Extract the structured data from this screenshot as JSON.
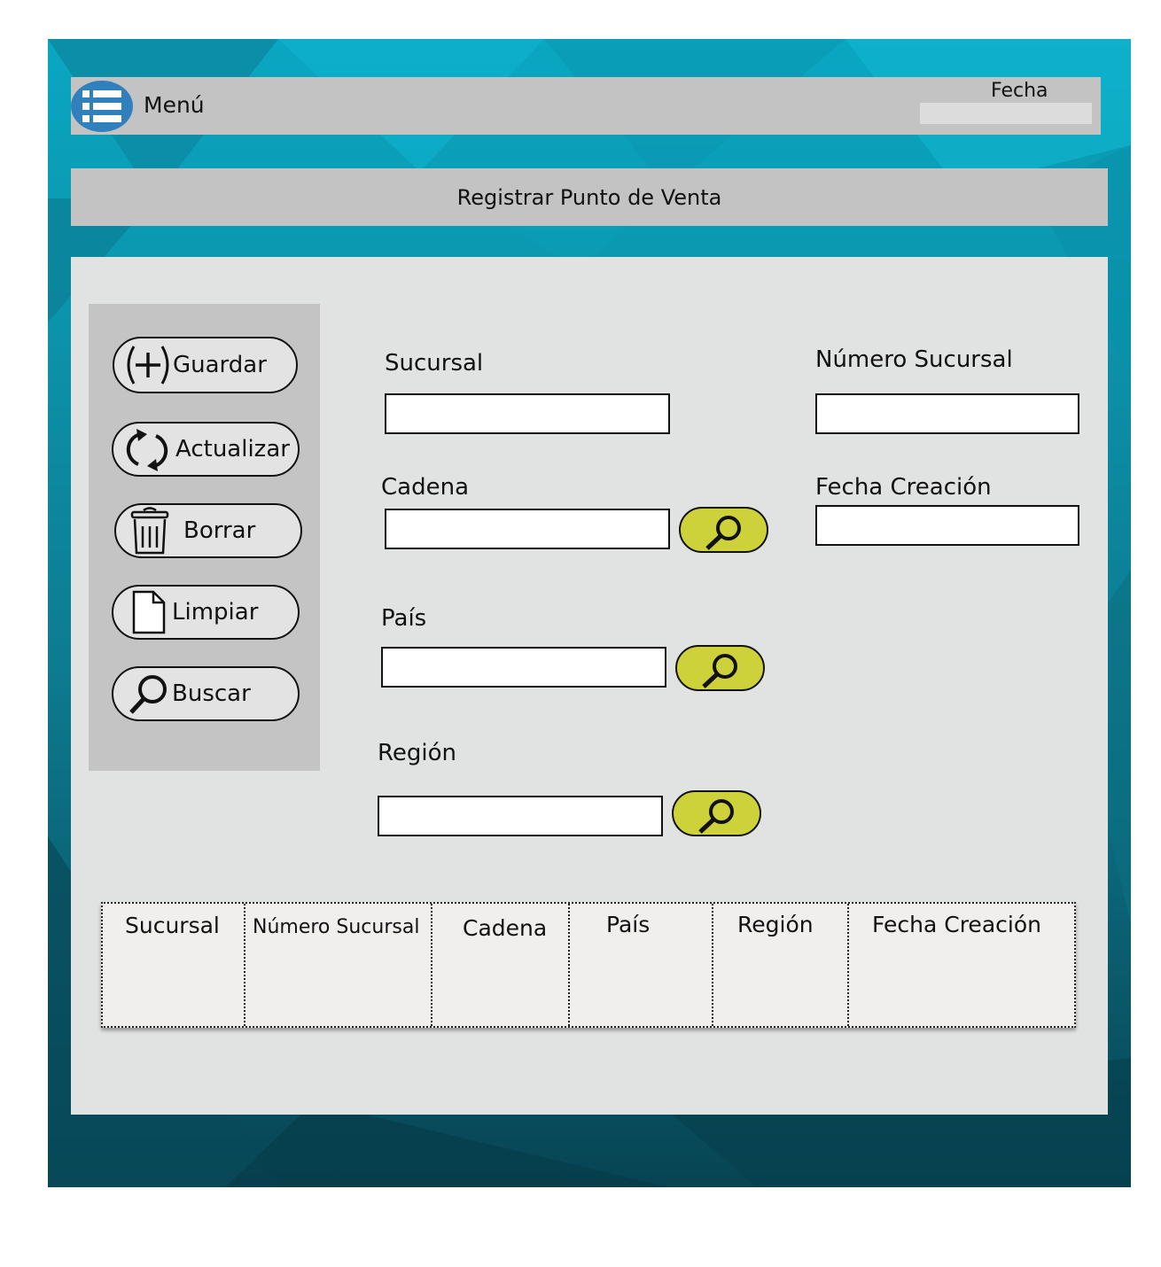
{
  "header": {
    "menu_label": "Menú",
    "fecha_label": "Fecha",
    "fecha_value": ""
  },
  "title": "Registrar Punto de Venta",
  "toolbar": {
    "guardar": "Guardar",
    "actualizar": "Actualizar",
    "borrar": "Borrar",
    "limpiar": "Limpiar",
    "buscar": "Buscar"
  },
  "form": {
    "sucursal": {
      "label": "Sucursal",
      "value": ""
    },
    "numero_sucursal": {
      "label": "Número Sucursal",
      "value": ""
    },
    "cadena": {
      "label": "Cadena",
      "value": ""
    },
    "fecha_creacion": {
      "label": "Fecha Creación",
      "value": ""
    },
    "pais": {
      "label": "País",
      "value": ""
    },
    "region": {
      "label": "Región",
      "value": ""
    }
  },
  "table": {
    "columns": [
      "Sucursal",
      "Número Sucursal",
      "Cadena",
      "País",
      "Región",
      "Fecha Creación"
    ],
    "rows": []
  },
  "colors": {
    "background": "#0c7d92",
    "bar": "#c3c3c3",
    "panel": "#e1e2e2",
    "menu_button": "#2f80bd",
    "search_button": "#cdd23a",
    "table_bg": "#f1efee"
  },
  "icons": {
    "menu": "list-icon",
    "guardar": "plus-circle-icon",
    "actualizar": "refresh-icon",
    "borrar": "trash-icon",
    "limpiar": "blank-document-icon",
    "buscar": "magnifier-icon",
    "search": "magnifier-icon"
  }
}
